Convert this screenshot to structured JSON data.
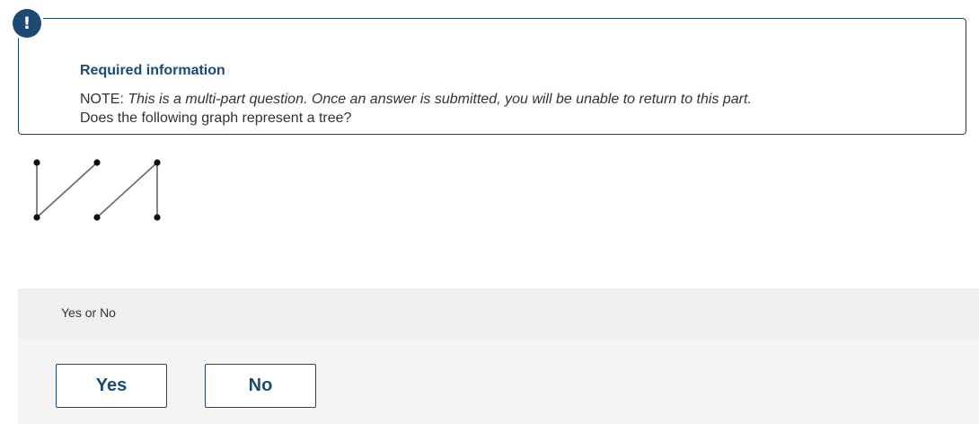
{
  "info_card": {
    "badge_symbol": "!",
    "title": "Required information",
    "note_label": "NOTE:",
    "note_text": "This is a multi-part question. Once an answer is submitted, you will be unable to return to this part.",
    "question": "Does the following graph represent a tree?"
  },
  "graph": {
    "vertex_count": 6,
    "edge_count": 4
  },
  "answer": {
    "prompt": "Yes or No",
    "options": [
      "Yes",
      "No"
    ]
  },
  "colors": {
    "accent": "#1c4a73",
    "panel_header": "#efefef",
    "panel_body": "#f5f5f5"
  },
  "icons": {
    "badge": "exclamation-icon"
  }
}
